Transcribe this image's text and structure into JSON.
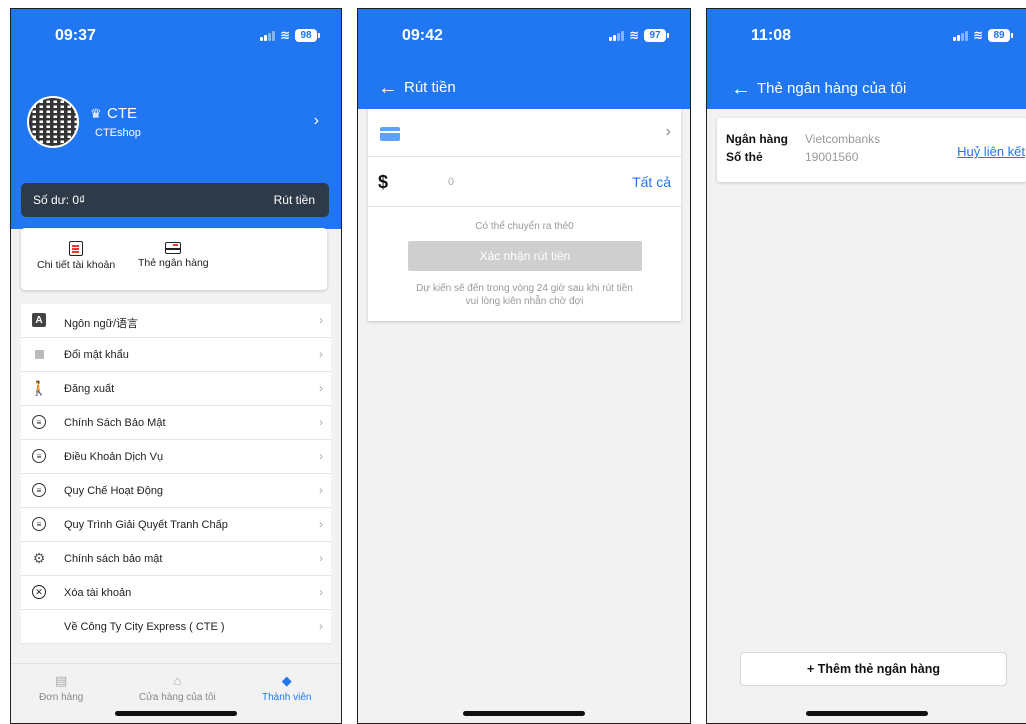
{
  "profile_screen": {
    "status": {
      "time": "09:37",
      "battery": "98"
    },
    "user": {
      "name": "CTE",
      "shop": "CTEshop"
    },
    "balance": {
      "label": "Số dư: 0₫",
      "withdraw": "Rút tiền"
    },
    "quick_actions": [
      "Chi tiết tài khoản",
      "Thẻ ngân hàng"
    ],
    "menu": [
      {
        "label": "Ngôn ngữ/语言",
        "icon": "language-icon"
      },
      {
        "label": "Đổi mật khẩu",
        "icon": "lock-icon"
      },
      {
        "label": "Đăng xuất",
        "icon": "walk-icon"
      },
      {
        "label": "Chính Sách Bảo Mật",
        "icon": "list-icon"
      },
      {
        "label": "Điều Khoản Dịch Vụ",
        "icon": "list-icon"
      },
      {
        "label": "Quy Chế Hoạt Động",
        "icon": "list-icon"
      },
      {
        "label": "Quy Trình Giải Quyết Tranh Chấp",
        "icon": "list-icon"
      },
      {
        "label": "Chính sách bảo mật",
        "icon": "gear-icon"
      },
      {
        "label": "Xóa tài khoản",
        "icon": "close-circle-icon"
      },
      {
        "label": "Về Công Ty City Express ( CTE )",
        "icon": ""
      }
    ],
    "tabs": [
      "Đơn hàng",
      "Cửa hàng của tôi",
      "Thành viên"
    ],
    "active_tab": "Thành viên"
  },
  "withdraw_screen": {
    "status": {
      "time": "09:42",
      "battery": "97"
    },
    "title": "Rút tiền",
    "currency": "$",
    "amount": "0",
    "all_label": "Tất cả",
    "available": "Có thể chuyển ra thẻ0",
    "confirm": "Xác nhận rút tiền",
    "note_line1": "Dự kiến sẽ đến trong vòng 24 giờ sau khi rút tiền",
    "note_line2": "vui lòng kiên nhẫn chờ đợi"
  },
  "bank_screen": {
    "status": {
      "time": "11:08",
      "battery": "89"
    },
    "title": "Thẻ ngân hàng của tôi",
    "bank_label": "Ngân hàng",
    "bank_value": "Vietcombanks",
    "card_label": "Số thẻ",
    "card_value": "19001560",
    "unlink": "Huỷ liên kết",
    "add_button": "+ Thêm thẻ ngân hàng"
  },
  "colors": {
    "primary": "#2177f2",
    "balance_bar": "#2f3a48",
    "background": "#f2f2f2"
  }
}
